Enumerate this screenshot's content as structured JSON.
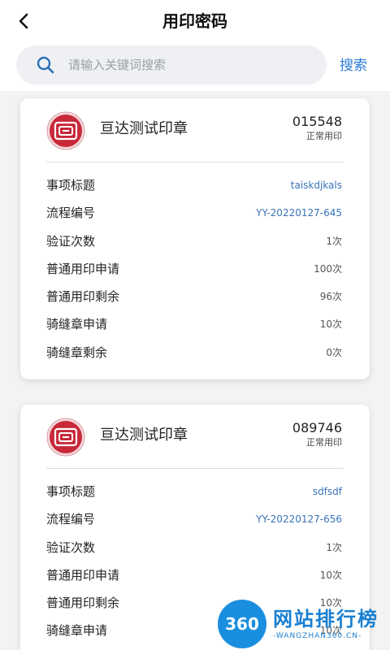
{
  "header": {
    "title": "用印密码",
    "back_icon": "chevron-left-icon"
  },
  "search": {
    "placeholder": "请输入关键词搜索",
    "value": "",
    "button_label": "搜索",
    "icon": "search-icon"
  },
  "cards": [
    {
      "seal_name": "亘达测试印章",
      "seal_code": "015548",
      "seal_type": "正常用印",
      "rows": [
        {
          "label": "事项标题",
          "value": "taiskdjkals"
        },
        {
          "label": "流程编号",
          "value": "YY-20220127-645"
        },
        {
          "label": "验证次数",
          "value": "1次"
        },
        {
          "label": "普通用印申请",
          "value": "100次"
        },
        {
          "label": "普通用印剩余",
          "value": "96次"
        },
        {
          "label": "骑缝章申请",
          "value": "10次"
        },
        {
          "label": "骑缝章剩余",
          "value": "0次"
        }
      ]
    },
    {
      "seal_name": "亘达测试印章",
      "seal_code": "089746",
      "seal_type": "正常用印",
      "rows": [
        {
          "label": "事项标题",
          "value": "sdfsdf"
        },
        {
          "label": "流程编号",
          "value": "YY-20220127-656"
        },
        {
          "label": "验证次数",
          "value": "1次"
        },
        {
          "label": "普通用印申请",
          "value": "10次"
        },
        {
          "label": "普通用印剩余",
          "value": "10次"
        },
        {
          "label": "骑缝章申请",
          "value": "10次"
        }
      ]
    }
  ],
  "watermark": {
    "badge": "360",
    "main": "网站排行榜",
    "sub": "-WANGZHAN360.CN-"
  },
  "colors": {
    "accent": "#2b7bd6",
    "link": "#3a73b8",
    "seal_red": "#c8283a",
    "background": "#f3f3f3"
  }
}
